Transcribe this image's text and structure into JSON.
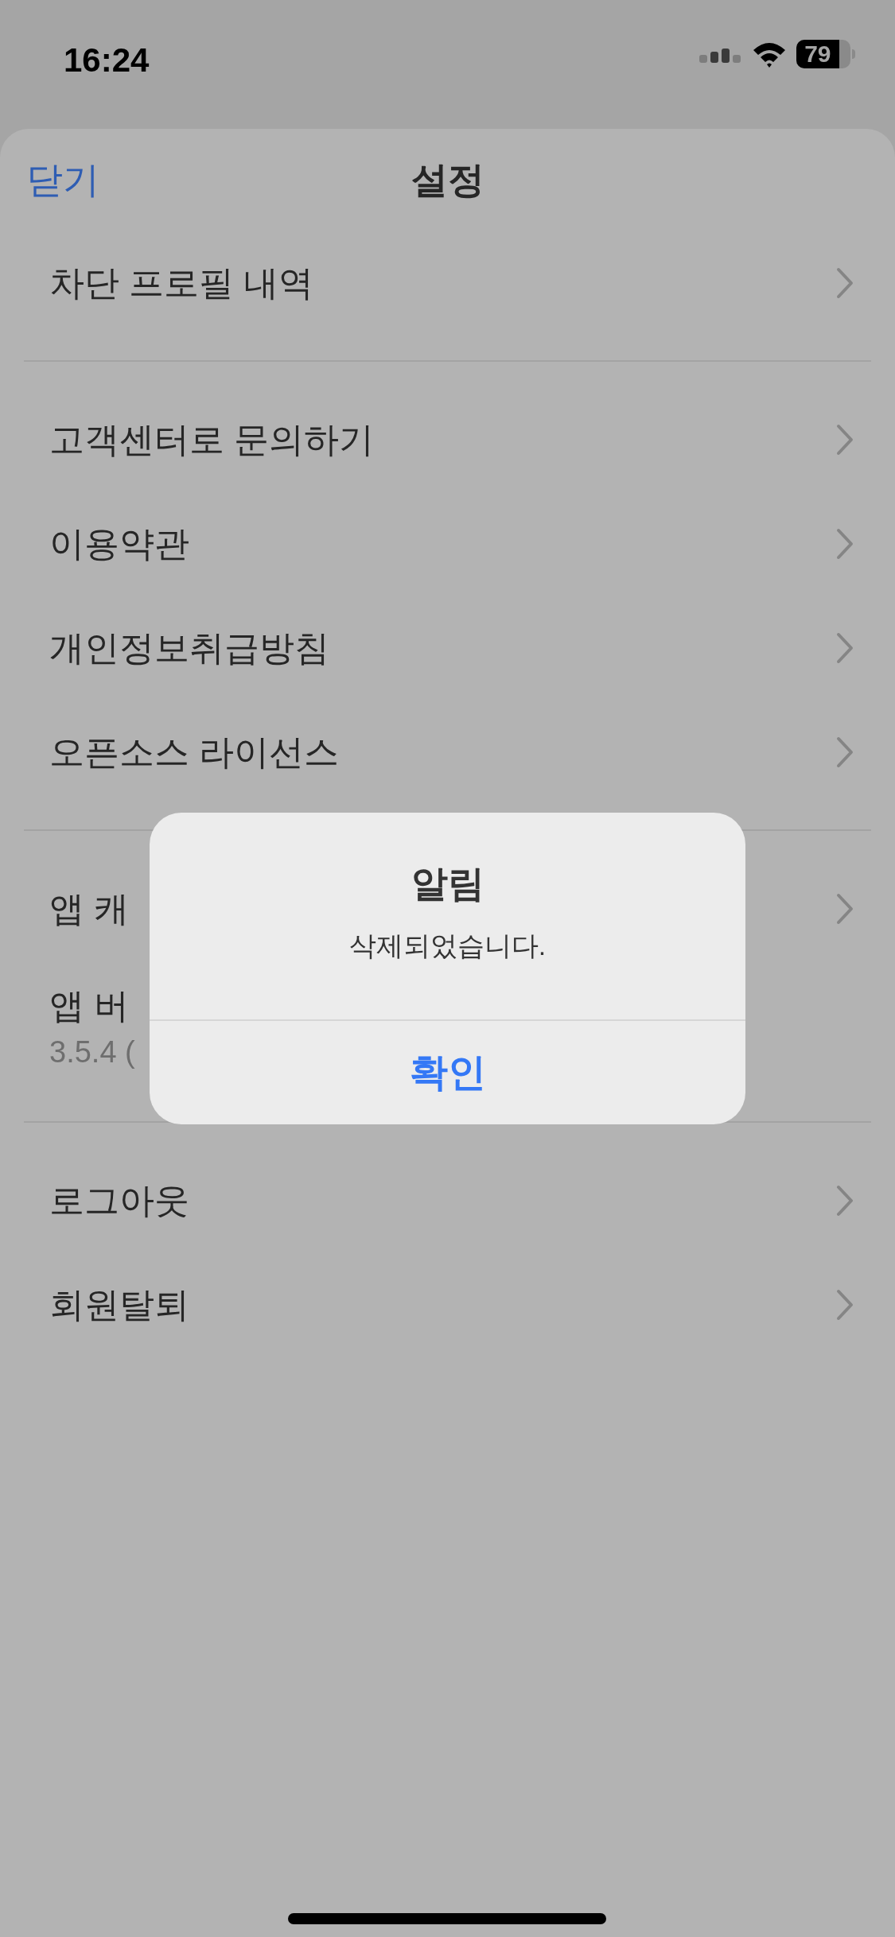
{
  "status_bar": {
    "time": "16:24",
    "battery": "79"
  },
  "sheet": {
    "close": "닫기",
    "title": "설정"
  },
  "sections": [
    {
      "rows": [
        {
          "kind": "link",
          "label": "차단 프로필 내역"
        }
      ]
    },
    {
      "rows": [
        {
          "kind": "link",
          "label": "고객센터로 문의하기"
        },
        {
          "kind": "link",
          "label": "이용약관"
        },
        {
          "kind": "link",
          "label": "개인정보취급방침"
        },
        {
          "kind": "link",
          "label": "오픈소스 라이선스"
        }
      ]
    },
    {
      "rows": [
        {
          "kind": "link",
          "label": "앱 캐"
        },
        {
          "kind": "info",
          "label": "앱 버",
          "value": "3.5.4 ("
        }
      ]
    },
    {
      "rows": [
        {
          "kind": "link",
          "label": "로그아웃"
        },
        {
          "kind": "link",
          "label": "회원탈퇴"
        }
      ]
    }
  ],
  "alert": {
    "title": "알림",
    "message": "삭제되었습니다.",
    "button": "확인"
  }
}
